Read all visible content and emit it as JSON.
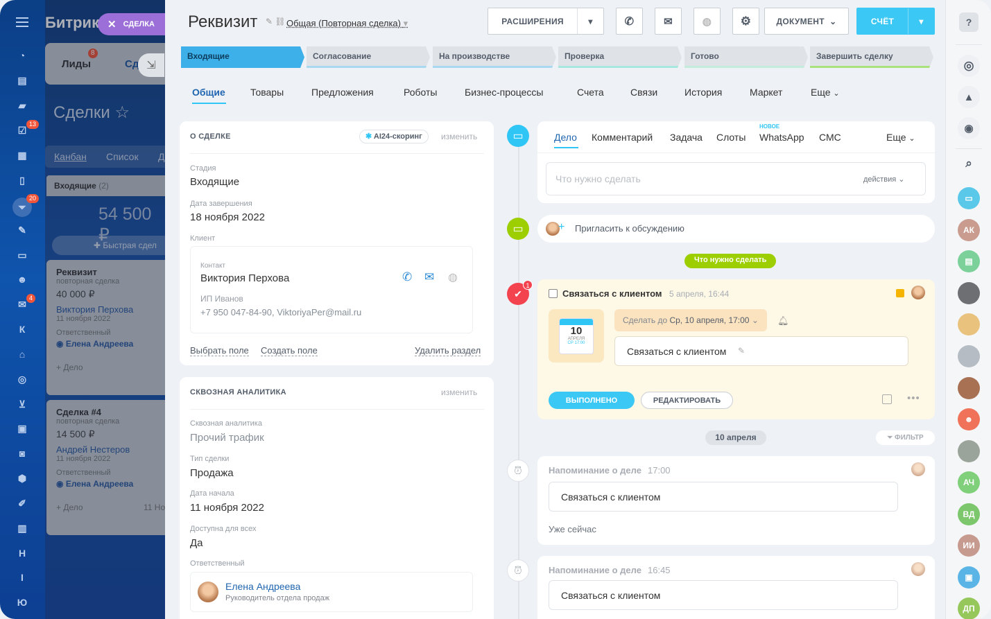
{
  "left_nav": {
    "badges": {
      "deals": "13",
      "funnel": "20",
      "mail": "4"
    },
    "letters": [
      "К",
      "Н",
      "I",
      "Ю"
    ]
  },
  "bg_crm": {
    "app_name": "Битрикс",
    "tabs_top": {
      "leads": "Лиды",
      "leads_badge": "8",
      "deals": "Сд"
    },
    "close_chip": "СДЕЛКА",
    "title": "Сделки",
    "view_tabs": [
      "Канбан",
      "Список",
      "Д"
    ],
    "column": {
      "name": "Входящие",
      "count": "(2)",
      "sum": "54 500 ₽",
      "quick": "Быстрая сдел"
    },
    "cards": [
      {
        "title": "Реквизит",
        "type": "повторная сделка",
        "sum": "40 000 ₽",
        "contact": "Виктория Перхова",
        "date": "11 ноября 2022",
        "resp_label": "Ответственный",
        "resp": "Елена Андреева",
        "add": "+ Дело",
        "extra": ""
      },
      {
        "title": "Сделка #4",
        "type": "повторная сделка",
        "sum": "14 500 ₽",
        "contact": "Андрей Нестеров",
        "date": "11 ноября 2022",
        "resp_label": "Ответственный",
        "resp": "Елена Андреева",
        "add": "+ Дело",
        "extra": "11 Но"
      }
    ]
  },
  "header": {
    "title": "Реквизит",
    "pipeline": "Общая (Повторная сделка)",
    "buttons": {
      "extensions": "РАСШИРЕНИЯ",
      "document": "ДОКУМЕНТ",
      "invoice": "СЧЁТ"
    }
  },
  "stages": [
    "Входящие",
    "Согласование",
    "На производстве",
    "Проверка",
    "Готово",
    "Завершить сделку"
  ],
  "tabs": [
    "Общие",
    "Товары",
    "Предложения",
    "Роботы",
    "Бизнес-процессы",
    "Счета",
    "Связи",
    "История",
    "Маркет",
    "Еще"
  ],
  "about": {
    "header": "О СДЕЛКЕ",
    "ai_chip": "AI24-скоринг",
    "edit": "изменить",
    "stage_label": "Стадия",
    "stage": "Входящие",
    "close_label": "Дата завершения",
    "close": "18 ноября 2022",
    "client_label": "Клиент",
    "contact_label": "Контакт",
    "contact": "Виктория Перхова",
    "company": "ИП Иванов",
    "contact_info": "+7 950 047-84-90, ViktoriyaPer@mail.ru",
    "links": {
      "choose": "Выбрать поле",
      "create": "Создать поле",
      "delete": "Удалить раздел"
    }
  },
  "analytics": {
    "header": "СКВОЗНАЯ АНАЛИТИКА",
    "edit": "изменить",
    "fields": [
      {
        "label": "Сквозная аналитика",
        "value": "Прочий трафик"
      },
      {
        "label": "Тип сделки",
        "value": "Продажа"
      },
      {
        "label": "Дата начала",
        "value": "11 ноября 2022"
      },
      {
        "label": "Доступна для всех",
        "value": "Да"
      }
    ],
    "resp_label": "Ответственный",
    "resp_name": "Елена Андреева",
    "resp_title": "Руководитель отдела продаж"
  },
  "feed": {
    "tabs": [
      "Дело",
      "Комментарий",
      "Задача",
      "Слоты",
      "WhatsApp",
      "СМС",
      "Еще"
    ],
    "new_tag": "НОВОЕ",
    "placeholder": "Что нужно сделать",
    "actions": "действия",
    "invite": "Пригласить к обсуждению",
    "todo_badge": "Что нужно сделать",
    "task": {
      "title": "Связаться с клиентом",
      "time": "5 апреля, 16:44",
      "badge": "1",
      "cal_day": "10",
      "cal_month": "АПРЕЛЯ",
      "cal_time": "СР 17:00",
      "deadline_prefix": "Сделать до",
      "deadline": "Ср, 10 апреля, 17:00",
      "text": "Связаться с клиентом",
      "done": "ВЫПОЛНЕНО",
      "edit": "РЕДАКТИРОВАТЬ"
    },
    "date_sep": "10 апреля",
    "filter": "ФИЛЬТР",
    "reminders": [
      {
        "title": "Напоминание о деле",
        "time": "17:00",
        "text": "Связаться с клиентом",
        "note": "Уже сейчас"
      },
      {
        "title": "Напоминание о деле",
        "time": "16:45",
        "text": "Связаться с клиентом",
        "note": ""
      }
    ]
  },
  "right_avatars": [
    "АК",
    "АЧ",
    "ВД",
    "ИИ",
    "ДП"
  ]
}
